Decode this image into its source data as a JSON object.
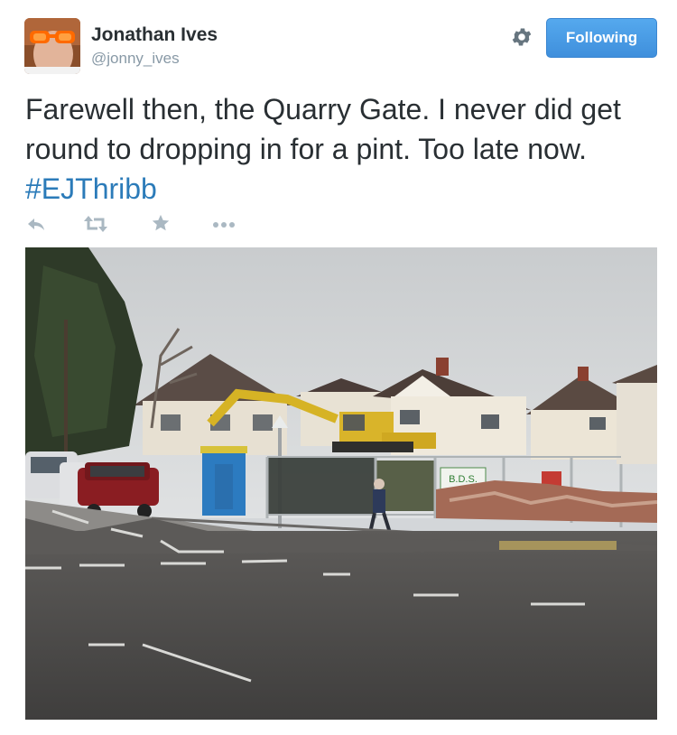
{
  "author": {
    "name": "Jonathan Ives",
    "handle": "@jonny_ives"
  },
  "follow_button": {
    "label": "Following"
  },
  "tweet": {
    "text": "Farewell then, the Quarry Gate. I never did get round to dropping in for a pint. Too late now.",
    "hashtag": "#EJThribb"
  },
  "actions": [
    {
      "icon": "reply-icon"
    },
    {
      "icon": "retweet-icon"
    },
    {
      "icon": "favorite-star-icon"
    },
    {
      "icon": "more-dots-icon"
    }
  ],
  "photo": {
    "sign_text": "B.D.S."
  },
  "colors": {
    "follow_button": "#4a9be6",
    "hashtag": "#2b7bb9",
    "muted": "#8899a6",
    "text": "#292f33"
  }
}
